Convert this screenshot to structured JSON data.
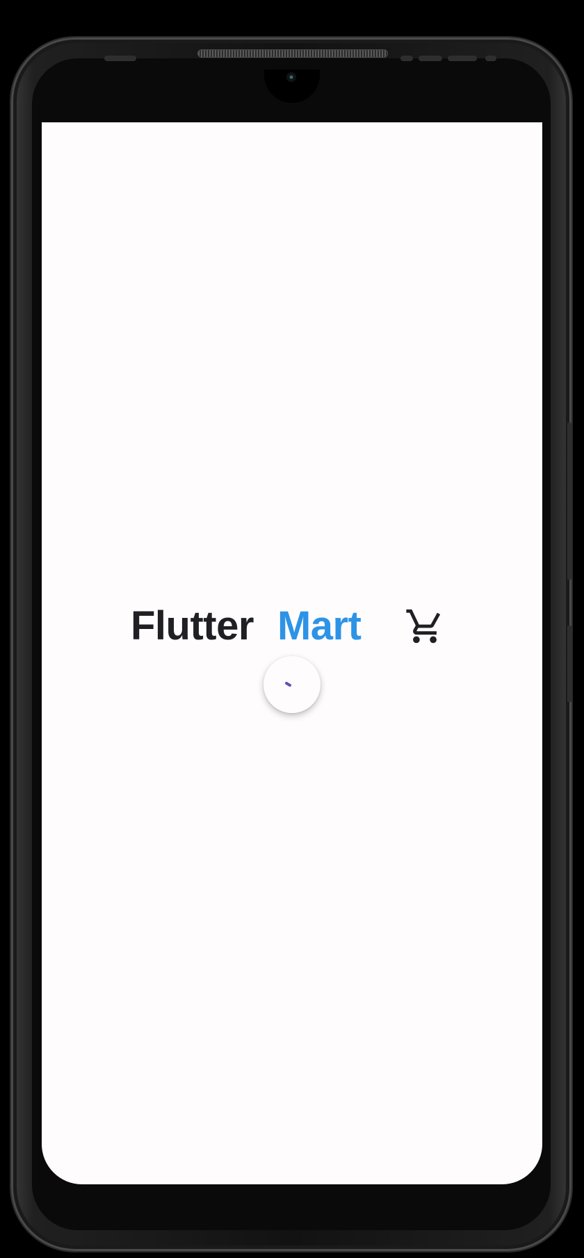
{
  "app": {
    "brand_first": "Flutter",
    "brand_second": "Mart"
  },
  "icons": {
    "cart": "shopping-cart-icon",
    "loader": "loading-spinner"
  },
  "colors": {
    "screen_background": "#fffcfe",
    "brand_first": "#1f1f24",
    "brand_second": "#2d93e6",
    "spinner": "#6a4bb8"
  }
}
